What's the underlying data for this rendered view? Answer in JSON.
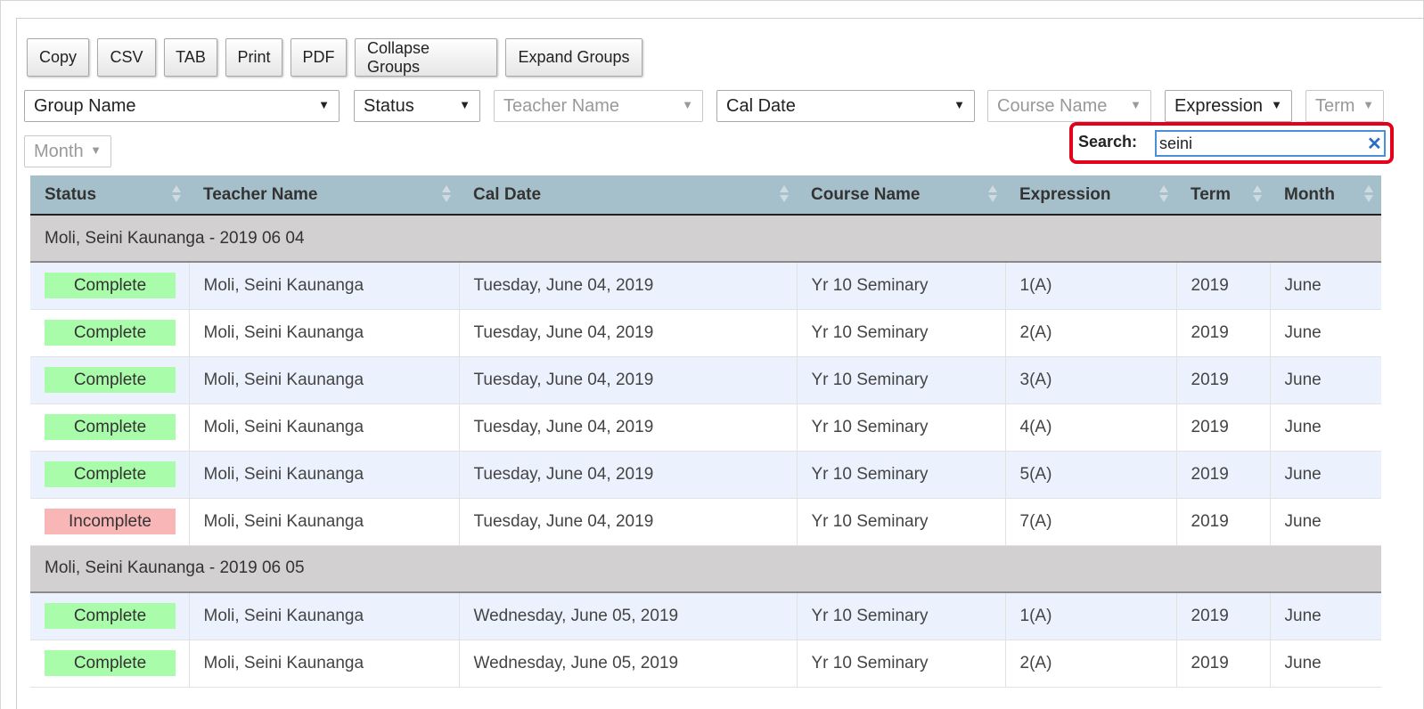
{
  "toolbar": {
    "buttons": [
      "Copy",
      "CSV",
      "TAB",
      "Print",
      "PDF",
      "Collapse Groups",
      "Expand Groups"
    ]
  },
  "filters": {
    "group_name": "Group Name",
    "status": "Status",
    "teacher_name": "Teacher Name",
    "cal_date": "Cal Date",
    "course_name": "Course Name",
    "expression": "Expression",
    "term": "Term",
    "month": "Month"
  },
  "search": {
    "label": "Search:",
    "value": "seini",
    "clear_symbol": "✕"
  },
  "table": {
    "columns": [
      "Status",
      "Teacher Name",
      "Cal Date",
      "Course Name",
      "Expression",
      "Term",
      "Month"
    ],
    "groups": [
      {
        "title": "Moli, Seini Kaunanga - 2019 06 04",
        "rows": [
          {
            "status": "Complete",
            "teacher": "Moli, Seini Kaunanga",
            "date": "Tuesday, June 04, 2019",
            "course": "Yr 10 Seminary",
            "expression": "1(A)",
            "term": "2019",
            "month": "June"
          },
          {
            "status": "Complete",
            "teacher": "Moli, Seini Kaunanga",
            "date": "Tuesday, June 04, 2019",
            "course": "Yr 10 Seminary",
            "expression": "2(A)",
            "term": "2019",
            "month": "June"
          },
          {
            "status": "Complete",
            "teacher": "Moli, Seini Kaunanga",
            "date": "Tuesday, June 04, 2019",
            "course": "Yr 10 Seminary",
            "expression": "3(A)",
            "term": "2019",
            "month": "June"
          },
          {
            "status": "Complete",
            "teacher": "Moli, Seini Kaunanga",
            "date": "Tuesday, June 04, 2019",
            "course": "Yr 10 Seminary",
            "expression": "4(A)",
            "term": "2019",
            "month": "June"
          },
          {
            "status": "Complete",
            "teacher": "Moli, Seini Kaunanga",
            "date": "Tuesday, June 04, 2019",
            "course": "Yr 10 Seminary",
            "expression": "5(A)",
            "term": "2019",
            "month": "June"
          },
          {
            "status": "Incomplete",
            "teacher": "Moli, Seini Kaunanga",
            "date": "Tuesday, June 04, 2019",
            "course": "Yr 10 Seminary",
            "expression": "7(A)",
            "term": "2019",
            "month": "June"
          }
        ]
      },
      {
        "title": "Moli, Seini Kaunanga - 2019 06 05",
        "rows": [
          {
            "status": "Complete",
            "teacher": "Moli, Seini Kaunanga",
            "date": "Wednesday, June 05, 2019",
            "course": "Yr 10 Seminary",
            "expression": "1(A)",
            "term": "2019",
            "month": "June"
          },
          {
            "status": "Complete",
            "teacher": "Moli, Seini Kaunanga",
            "date": "Wednesday, June 05, 2019",
            "course": "Yr 10 Seminary",
            "expression": "2(A)",
            "term": "2019",
            "month": "June"
          }
        ]
      }
    ]
  },
  "colors": {
    "header_bg": "#a6c0cb",
    "group_bg": "#d2d0d1",
    "complete": "#a9fca9",
    "incomplete": "#f9b6b6",
    "search_highlight": "#e3001b"
  }
}
